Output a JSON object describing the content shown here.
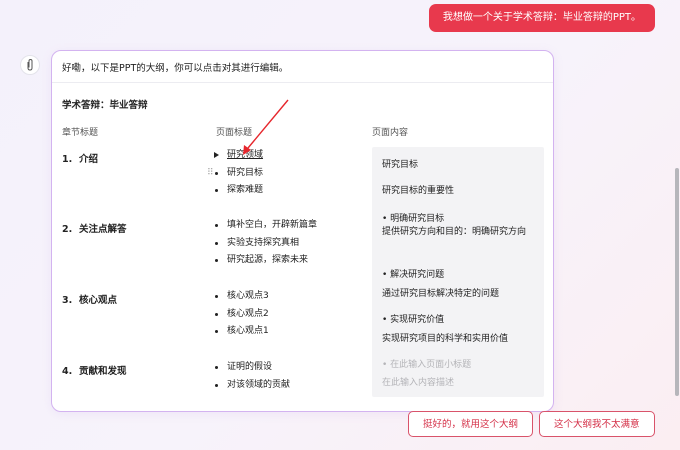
{
  "user_message": "我想做一个关于学术答辩：毕业答辩的PPT。",
  "bot": {
    "intro": "好嘞，以下是PPT的大纲，你可以点击对其进行编辑。",
    "doc_title": "学术答辩：毕业答辩",
    "columns": {
      "chapter": "章节标题",
      "page": "页面标题",
      "content": "页面内容"
    },
    "chapters": [
      {
        "num": "1.",
        "title": "介绍",
        "pages": [
          "研究领域",
          "研究目标",
          "探索难题"
        ]
      },
      {
        "num": "2.",
        "title": "关注点解答",
        "pages": [
          "填补空白，开辟新篇章",
          "实验支持探究真相",
          "研究起源，探索未来"
        ]
      },
      {
        "num": "3.",
        "title": "核心观点",
        "pages": [
          "核心观点3",
          "核心观点2",
          "核心观点1"
        ]
      },
      {
        "num": "4.",
        "title": "贡献和发现",
        "pages": [
          "证明的假设",
          "对该领域的贡献"
        ]
      }
    ],
    "content": {
      "heading": "研究目标",
      "subheading": "研究目标的重要性",
      "items": [
        {
          "title": "• 明确研究目标",
          "desc": "提供研究方向和目的：明确研究方向"
        },
        {
          "title": "• 解决研究问题",
          "desc": "通过研究目标解决特定的问题"
        },
        {
          "title": "• 实现研究价值",
          "desc": "实现研究项目的科学和实用价值"
        }
      ],
      "placeholder_title": "• 在此输入页面小标题",
      "placeholder_desc": "在此输入内容描述"
    }
  },
  "actions": {
    "accept": "挺好的，就用这个大纲",
    "reject": "这个大纲我不太满意"
  },
  "colors": {
    "accent": "#e8394d",
    "card_border": "#d3b3f0"
  }
}
